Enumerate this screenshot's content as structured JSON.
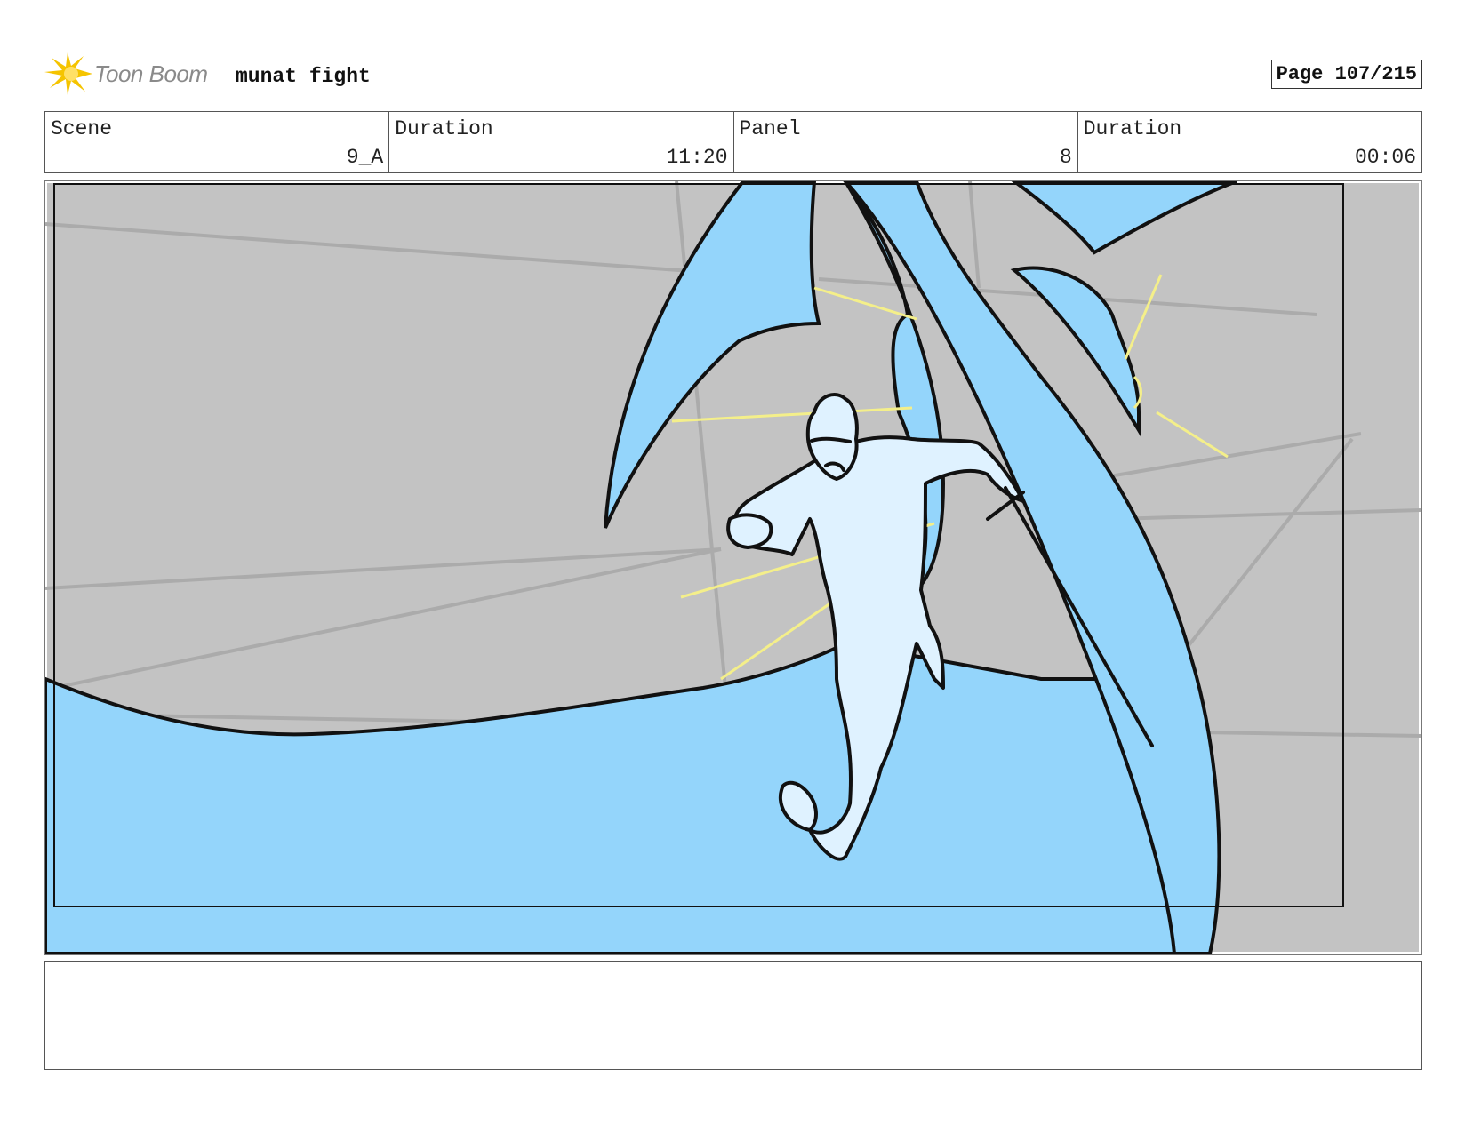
{
  "header": {
    "logo_text": "Toon Boom",
    "project_title": "munat fight",
    "page_label": "Page 107/215"
  },
  "info": {
    "scene_label": "Scene",
    "scene_value": "9_A",
    "scene_duration_label": "Duration",
    "scene_duration_value": "11:20",
    "panel_label": "Panel",
    "panel_value": "8",
    "panel_duration_label": "Duration",
    "panel_duration_value": "00:06"
  },
  "colors": {
    "sky_gray": "#c3c3c3",
    "fin_blue": "#94d5fb",
    "figure_blue": "#dff2ff",
    "flash_yellow": "#f4ef8a",
    "logo_yellow": "#f5c400"
  },
  "icons": {
    "logo": "toon-boom-starburst-icon"
  },
  "notes": {
    "text": ""
  }
}
